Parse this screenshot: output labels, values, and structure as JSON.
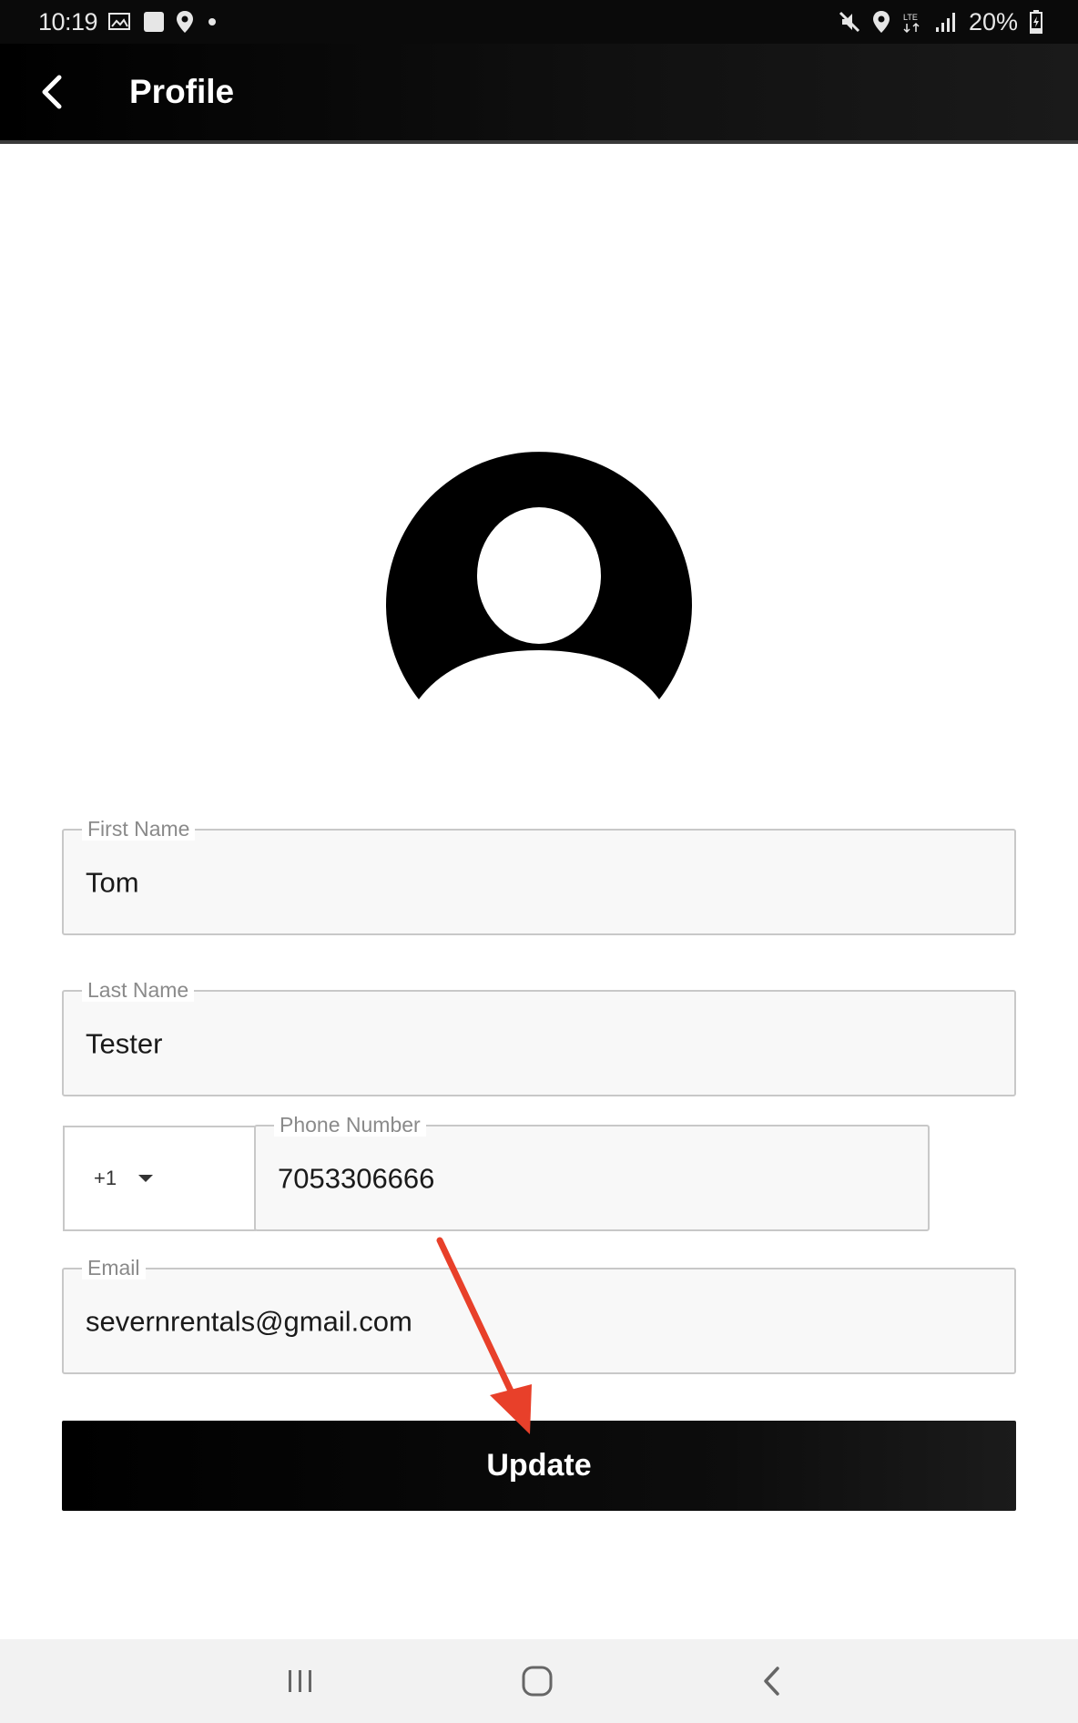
{
  "status_bar": {
    "time": "10:19",
    "battery": "20%",
    "icons_left": [
      "gallery-icon",
      "square-notification-icon",
      "location-icon",
      "dot-icon"
    ],
    "icons_right": [
      "mute-icon",
      "location-icon",
      "lte-icon",
      "signal-icon",
      "battery-icon"
    ]
  },
  "app_bar": {
    "title": "Profile",
    "back_icon": "chevron-left-icon"
  },
  "avatar": {
    "icon": "user-avatar-icon"
  },
  "form": {
    "first_name": {
      "label": "First Name",
      "value": "Tom"
    },
    "last_name": {
      "label": "Last Name",
      "value": "Tester"
    },
    "phone": {
      "country_code": "+1",
      "label": "Phone Number",
      "value": "7053306666"
    },
    "email": {
      "label": "Email",
      "value": "severnrentals@gmail.com"
    }
  },
  "actions": {
    "update_label": "Update"
  },
  "annotation": {
    "arrow_color": "#e8402a"
  },
  "nav_bar": {
    "recents_icon": "recents-icon",
    "home_icon": "home-icon",
    "back_icon": "back-icon"
  },
  "colors": {
    "app_bar": "#000000",
    "button": "#000000",
    "field_border": "#c8c8c8",
    "field_bg": "#f8f8f8"
  }
}
